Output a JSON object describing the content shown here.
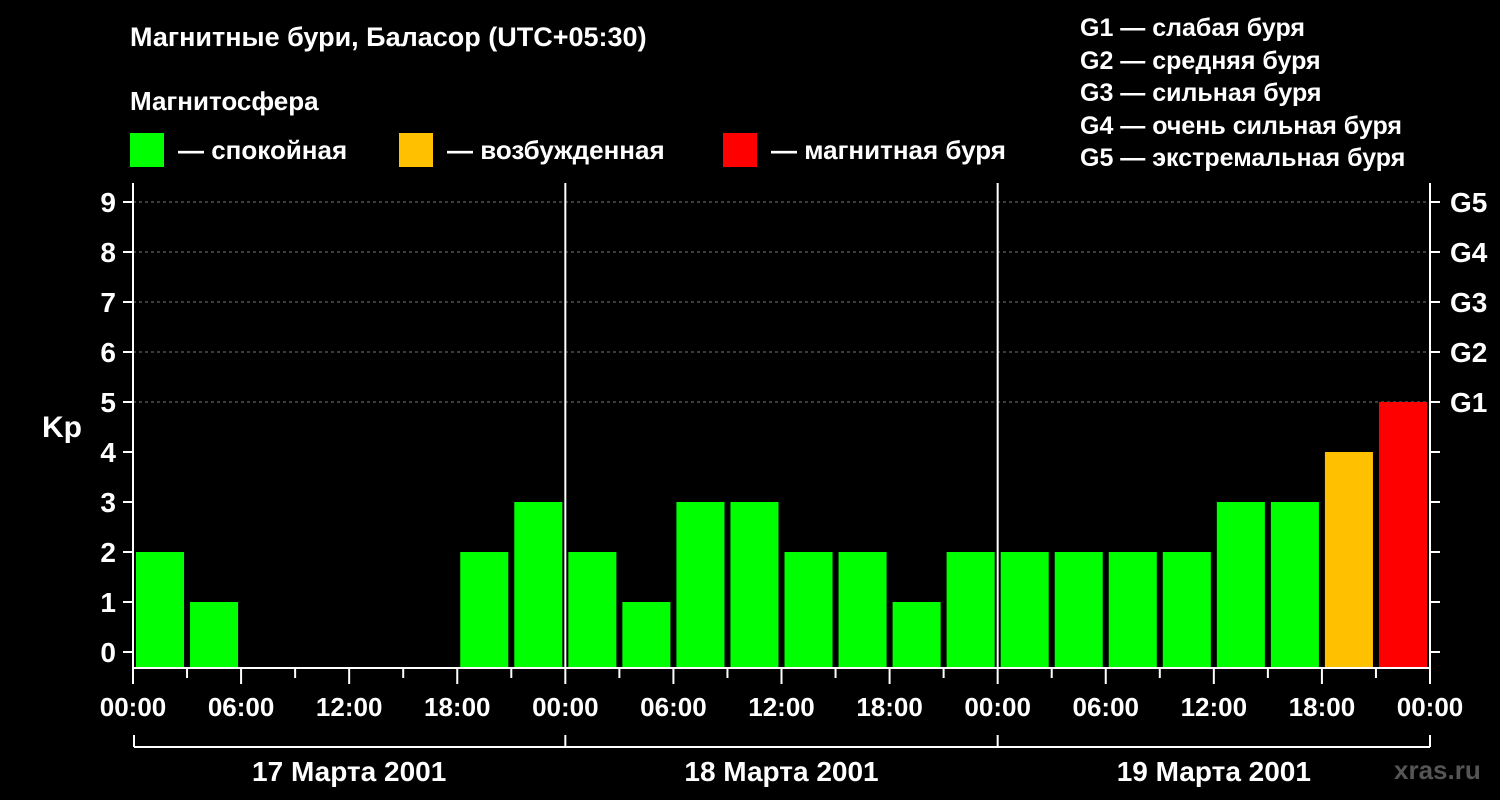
{
  "header": {
    "title": "Магнитные бури, Баласор (UTC+05:30)",
    "magnetosphere_label": "Магнитосфера"
  },
  "legend": [
    {
      "label": "— спокойная",
      "color": "#00ff00"
    },
    {
      "label": "— возбужденная",
      "color": "#ffc000"
    },
    {
      "label": "— магнитная буря",
      "color": "#ff0000"
    }
  ],
  "g_legend": [
    "G1 — слабая буря",
    "G2 — средняя буря",
    "G3 — сильная буря",
    "G4 — очень сильная буря",
    "G5 — экстремальная буря"
  ],
  "watermark": "xras.ru",
  "chart_data": {
    "type": "bar",
    "ylabel": "Kp",
    "ylim": [
      0,
      9
    ],
    "y_ticks": [
      "0",
      "1",
      "2",
      "3",
      "4",
      "5",
      "6",
      "7",
      "8",
      "9"
    ],
    "right_ticks": [
      {
        "kp": 5,
        "label": "G1"
      },
      {
        "kp": 6,
        "label": "G2"
      },
      {
        "kp": 7,
        "label": "G3"
      },
      {
        "kp": 8,
        "label": "G4"
      },
      {
        "kp": 9,
        "label": "G5"
      }
    ],
    "x_range_hours": [
      0,
      72
    ],
    "x_tick_labels": [
      "00:00",
      "06:00",
      "12:00",
      "18:00",
      "00:00",
      "06:00",
      "12:00",
      "18:00",
      "00:00",
      "06:00",
      "12:00",
      "18:00",
      "00:00"
    ],
    "days": [
      "17 Марта 2001",
      "18 Марта 2001",
      "19 Марта 2001"
    ],
    "grid": "dashed horizontal lines at Kp 5–9",
    "colors": {
      "quiet": "#00ff00",
      "active": "#ffc000",
      "storm": "#ff0000"
    },
    "bars": [
      {
        "start_hour": 0,
        "end_hour": 3,
        "kp": 2,
        "level": "quiet"
      },
      {
        "start_hour": 3,
        "end_hour": 6,
        "kp": 1,
        "level": "quiet"
      },
      {
        "start_hour": 6,
        "end_hour": 9,
        "kp": 0,
        "level": "quiet"
      },
      {
        "start_hour": 9,
        "end_hour": 12,
        "kp": 0,
        "level": "quiet"
      },
      {
        "start_hour": 12,
        "end_hour": 15,
        "kp": 0,
        "level": "quiet"
      },
      {
        "start_hour": 15,
        "end_hour": 18,
        "kp": 0,
        "level": "quiet"
      },
      {
        "start_hour": 18,
        "end_hour": 21,
        "kp": 2,
        "level": "quiet"
      },
      {
        "start_hour": 21,
        "end_hour": 24,
        "kp": 3,
        "level": "quiet"
      },
      {
        "start_hour": 24,
        "end_hour": 27,
        "kp": 2,
        "level": "quiet"
      },
      {
        "start_hour": 27,
        "end_hour": 30,
        "kp": 1,
        "level": "quiet"
      },
      {
        "start_hour": 30,
        "end_hour": 33,
        "kp": 3,
        "level": "quiet"
      },
      {
        "start_hour": 33,
        "end_hour": 36,
        "kp": 3,
        "level": "quiet"
      },
      {
        "start_hour": 36,
        "end_hour": 39,
        "kp": 2,
        "level": "quiet"
      },
      {
        "start_hour": 39,
        "end_hour": 42,
        "kp": 2,
        "level": "quiet"
      },
      {
        "start_hour": 42,
        "end_hour": 45,
        "kp": 1,
        "level": "quiet"
      },
      {
        "start_hour": 45,
        "end_hour": 48,
        "kp": 2,
        "level": "quiet"
      },
      {
        "start_hour": 48,
        "end_hour": 51,
        "kp": 2,
        "level": "quiet"
      },
      {
        "start_hour": 51,
        "end_hour": 54,
        "kp": 2,
        "level": "quiet"
      },
      {
        "start_hour": 54,
        "end_hour": 57,
        "kp": 2,
        "level": "quiet"
      },
      {
        "start_hour": 57,
        "end_hour": 60,
        "kp": 2,
        "level": "quiet"
      },
      {
        "start_hour": 60,
        "end_hour": 63,
        "kp": 3,
        "level": "quiet"
      },
      {
        "start_hour": 63,
        "end_hour": 66,
        "kp": 3,
        "level": "quiet"
      },
      {
        "start_hour": 66,
        "end_hour": 69,
        "kp": 4,
        "level": "active"
      },
      {
        "start_hour": 69,
        "end_hour": 72,
        "kp": 5,
        "level": "storm"
      }
    ]
  }
}
